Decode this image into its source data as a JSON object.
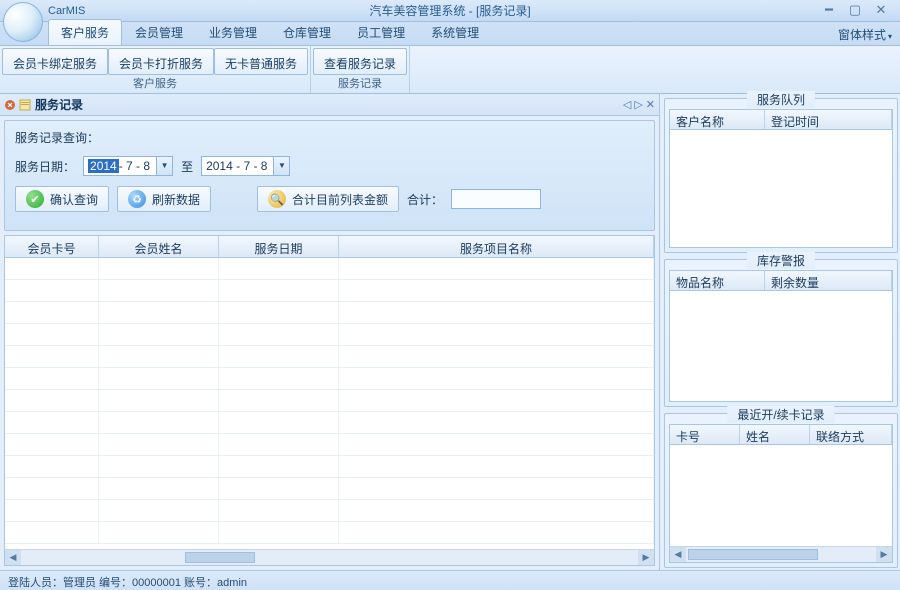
{
  "app": {
    "name": "CarMIS",
    "title": "汽车美容管理系统 - [服务记录]"
  },
  "ribbon": {
    "tabs": [
      "客户服务",
      "会员管理",
      "业务管理",
      "仓库管理",
      "员工管理",
      "系统管理"
    ],
    "right": "窗体样式",
    "groups": [
      {
        "buttons": [
          "会员卡绑定服务",
          "会员卡打折服务",
          "无卡普通服务"
        ],
        "label": "客户服务"
      },
      {
        "buttons": [
          "查看服务记录"
        ],
        "label": "服务记录"
      }
    ]
  },
  "doc": {
    "tab_title": "服务记录",
    "query_label": "服务记录查询：",
    "date_label": "服务日期：",
    "date_from_year": "2014",
    "date_from_rest": " - 7 - 8",
    "to_label": "至",
    "date_to": "2014 - 7 - 8",
    "btn_confirm": "确认查询",
    "btn_refresh": "刷新数据",
    "btn_sumcol": "合计目前列表金额",
    "sum_label": "合计：",
    "sum_value": "",
    "grid_cols": [
      "会员卡号",
      "会员姓名",
      "服务日期",
      "服务项目名称"
    ]
  },
  "side": {
    "g1": {
      "title": "服务队列",
      "cols": [
        "客户名称",
        "登记时间"
      ]
    },
    "g2": {
      "title": "库存警报",
      "cols": [
        "物品名称",
        "剩余数量"
      ]
    },
    "g3": {
      "title": "最近开/续卡记录",
      "cols": [
        "卡号",
        "姓名",
        "联络方式"
      ]
    }
  },
  "status": "登陆人员：管理员  编号：00000001  账号：admin"
}
